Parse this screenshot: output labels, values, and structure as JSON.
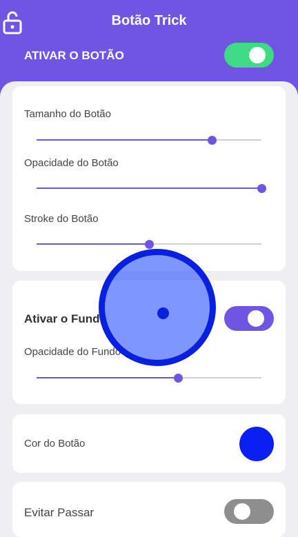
{
  "header": {
    "title": "Botão Trick",
    "activate_label": "ATIVAR O BOTÃO",
    "activate_on": true,
    "lock_icon": "unlocked-padlock-icon"
  },
  "button_settings": {
    "size": {
      "label": "Tamanho do Botão",
      "value": 0.78
    },
    "opacity": {
      "label": "Opacidade do Botão",
      "value": 1.0
    },
    "stroke": {
      "label": "Stroke do Botão",
      "value": 0.5
    }
  },
  "background_settings": {
    "enable_label": "Ativar o Fundo",
    "enable_on": true,
    "opacity": {
      "label": "Opacidade do Fundo",
      "value": 0.63
    }
  },
  "color_setting": {
    "label": "Cor do Botão",
    "color": "#0a1ff2"
  },
  "avoid_setting": {
    "label": "Evitar Passar",
    "on": false
  },
  "colors": {
    "accent": "#6f55e2",
    "switch_on_green": "#3ddc84",
    "switch_off": "#8e8e8e",
    "overlay_stroke": "#0a20e0"
  }
}
